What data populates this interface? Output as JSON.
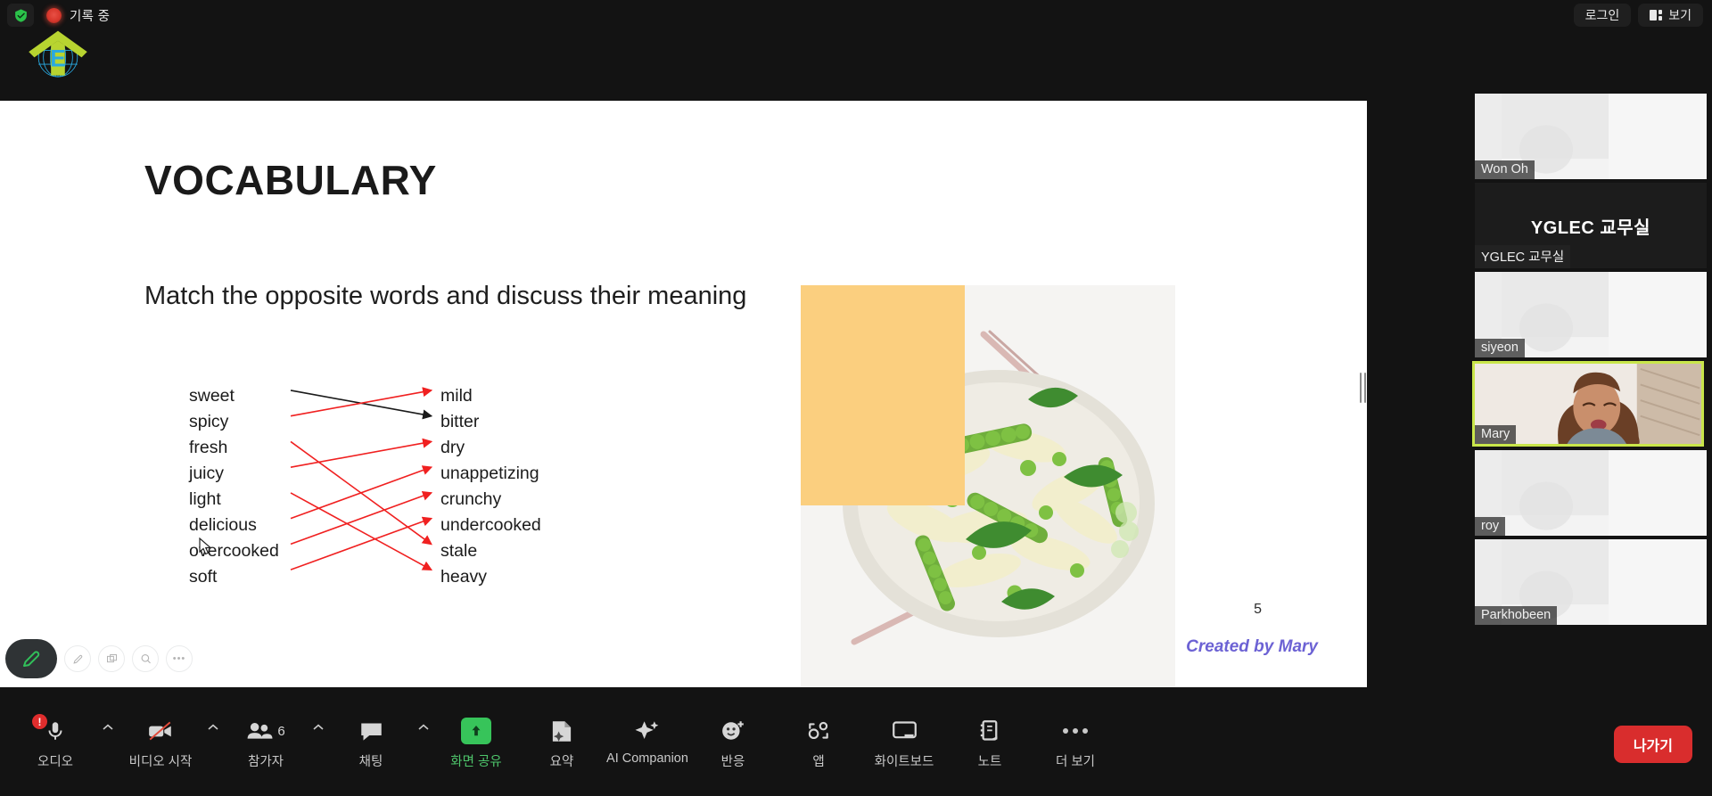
{
  "topbar": {
    "shield_icon": "shield-check-icon",
    "recording_dot": "recording-indicator-icon",
    "recording_label": "기록 중",
    "login_label": "로그인",
    "view_label": "보기",
    "view_icon": "grid-view-icon"
  },
  "logo": {
    "name": "yglec-logo",
    "letter": "E"
  },
  "slide": {
    "title": "VOCABULARY",
    "subtitle": "Match the opposite words and discuss their meaning",
    "left_words": [
      "sweet",
      "spicy",
      "fresh",
      "juicy",
      "light",
      "delicious",
      "overcooked",
      "soft"
    ],
    "right_words": [
      "mild",
      "bitter",
      "dry",
      "unappetizing",
      "crunchy",
      "undercooked",
      "stale",
      "heavy"
    ],
    "connections": [
      {
        "from": "sweet",
        "to": "bitter",
        "color": "#1a1a1a",
        "arrow": true
      },
      {
        "from": "spicy",
        "to": "mild",
        "color": "#f02020",
        "arrow": true
      },
      {
        "from": "juicy",
        "to": "dry",
        "color": "#f02020",
        "arrow": true
      },
      {
        "from": "fresh",
        "to": "stale",
        "color": "#f02020",
        "arrow": true
      },
      {
        "from": "light",
        "to": "heavy",
        "color": "#f02020",
        "arrow": true
      },
      {
        "from": "delicious",
        "to": "unappetizing",
        "color": "#f02020",
        "arrow": true
      },
      {
        "from": "overcooked",
        "to": "crunchy",
        "color": "#f02020",
        "arrow": true
      },
      {
        "from": "soft",
        "to": "undercooked",
        "color": "#f02020",
        "arrow": true
      }
    ],
    "page_number": "5",
    "credit": "Created by Mary",
    "accent_rect_color": "#fbcf7f",
    "credit_color": "#6c62d4"
  },
  "annotation_toolbar": {
    "items": [
      {
        "name": "pen-tool-button",
        "icon": "pen-icon",
        "active": true
      },
      {
        "name": "highlighter-tool-button",
        "icon": "pen-outline-icon",
        "active": false
      },
      {
        "name": "stamp-tool-button",
        "icon": "stamp-icon",
        "active": false
      },
      {
        "name": "zoom-tool-button",
        "icon": "magnifier-icon",
        "active": false
      },
      {
        "name": "more-tools-button",
        "icon": "ellipsis-icon",
        "active": false
      }
    ]
  },
  "participants": [
    {
      "name": "Won Oh",
      "type": "video",
      "active": false
    },
    {
      "name": "YGLEC 교무실",
      "type": "placeholder",
      "display_text": "YGLEC 교무실",
      "active": false
    },
    {
      "name": "siyeon",
      "type": "video",
      "active": false
    },
    {
      "name": "Mary",
      "type": "video",
      "active": true
    },
    {
      "name": "roy",
      "type": "video",
      "active": false
    },
    {
      "name": "Parkhobeen",
      "type": "video",
      "active": false
    }
  ],
  "active_speaker_color": "#c9e64a",
  "toolbar": {
    "items": [
      {
        "label": "오디오",
        "icon": "microphone-muted-icon",
        "caret": true,
        "badge": "!",
        "accent": false
      },
      {
        "label": "비디오 시작",
        "icon": "video-off-icon",
        "caret": true,
        "accent": false
      },
      {
        "label": "참가자",
        "icon": "participants-icon",
        "count": "6",
        "caret": true,
        "accent": false
      },
      {
        "label": "채팅",
        "icon": "chat-icon",
        "caret": true,
        "accent": false
      },
      {
        "label": "화면 공유",
        "icon": "share-screen-icon",
        "caret": false,
        "accent": true
      },
      {
        "label": "요약",
        "icon": "summary-icon",
        "caret": false,
        "accent": false
      },
      {
        "label": "AI Companion",
        "icon": "ai-companion-icon",
        "caret": false,
        "accent": false
      },
      {
        "label": "반응",
        "icon": "reactions-icon",
        "caret": false,
        "accent": false
      },
      {
        "label": "앱",
        "icon": "apps-icon",
        "caret": false,
        "accent": false
      },
      {
        "label": "화이트보드",
        "icon": "whiteboard-icon",
        "caret": false,
        "accent": false
      },
      {
        "label": "노트",
        "icon": "notes-icon",
        "caret": false,
        "accent": false
      },
      {
        "label": "더 보기",
        "icon": "ellipsis-icon",
        "caret": false,
        "accent": false
      }
    ],
    "leave_label": "나가기",
    "leave_color": "#d92d2d"
  }
}
